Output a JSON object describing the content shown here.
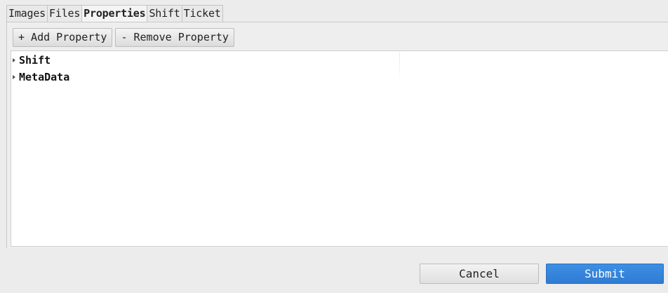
{
  "tabs": [
    {
      "label": "Images",
      "active": false
    },
    {
      "label": "Files",
      "active": false
    },
    {
      "label": "Properties",
      "active": true
    },
    {
      "label": "Shift",
      "active": false
    },
    {
      "label": "Ticket",
      "active": false
    }
  ],
  "toolbar": {
    "add_label": "+ Add Property",
    "remove_label": "- Remove Property"
  },
  "tree": {
    "items": [
      {
        "label": "Shift",
        "expanded": false
      },
      {
        "label": "MetaData",
        "expanded": false
      }
    ]
  },
  "footer": {
    "cancel_label": "Cancel",
    "submit_label": "Submit"
  },
  "colors": {
    "submit_bg": "#2f7bd3",
    "window_bg": "#ececec",
    "tree_bg": "#ffffff"
  },
  "icons": {
    "collapsed_arrow": "chevron-right-icon"
  }
}
